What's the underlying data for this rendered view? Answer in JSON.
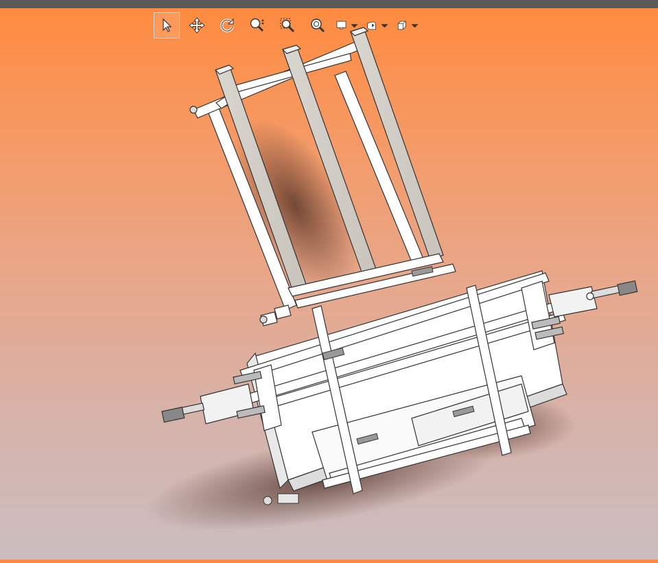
{
  "app": {
    "accent_top_bar": "#5a5a5a",
    "background_gradient": [
      "#ff8a3d",
      "#cbbdbf"
    ]
  },
  "toolbar": {
    "tools": [
      {
        "icon": "select-arrow-icon",
        "active": true
      },
      {
        "icon": "pan-move-icon",
        "active": false
      },
      {
        "icon": "rotate-icon",
        "active": false
      },
      {
        "icon": "zoom-in-out-icon",
        "active": false
      },
      {
        "icon": "zoom-to-area-icon",
        "active": false
      },
      {
        "icon": "zoom-to-fit-icon",
        "active": false
      },
      {
        "icon": "display-style-icon",
        "active": false,
        "dropdown": true
      },
      {
        "icon": "view-orientation-icon",
        "active": false,
        "dropdown": true
      },
      {
        "icon": "isometric-cube-icon",
        "active": false,
        "dropdown": true
      }
    ]
  },
  "viewport": {
    "content": "3d-machine-model"
  }
}
